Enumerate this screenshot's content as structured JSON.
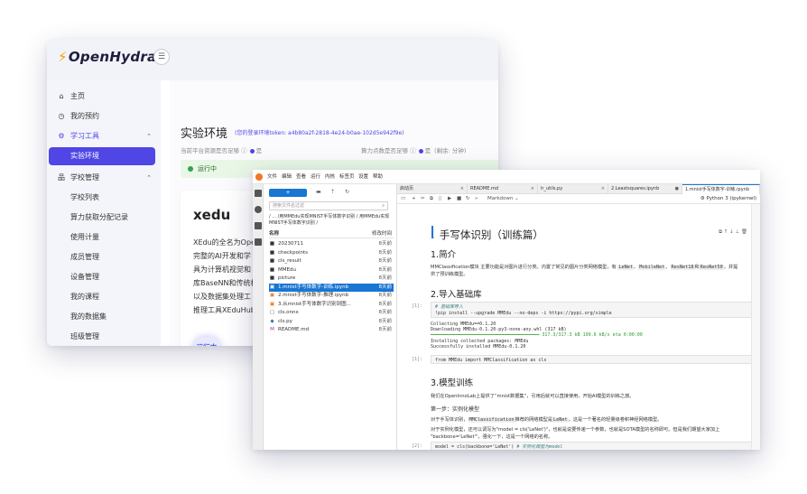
{
  "platform": {
    "logo_text": "OpenHydra",
    "collapse_icon": "collapse-icon",
    "nav": [
      {
        "label": "主页",
        "icon": "home-icon"
      },
      {
        "label": "我的预约",
        "icon": "clock-icon"
      },
      {
        "label": "学习工具",
        "icon": "gear-icon",
        "expanded_arrow": "⌃"
      },
      {
        "label": "实验环境",
        "active": true
      },
      {
        "label": "学校管理",
        "icon": "org-icon",
        "expanded_arrow": "⌃"
      },
      {
        "label": "学校列表"
      },
      {
        "label": "算力获取分配记录"
      },
      {
        "label": "使用计量"
      },
      {
        "label": "成员管理"
      },
      {
        "label": "设备管理"
      },
      {
        "label": "我的课程"
      },
      {
        "label": "我的数据集"
      },
      {
        "label": "班级管理"
      }
    ],
    "page_title": "实验环境",
    "token_text": "(您的登录环境token: a4b80a2f-2818-4e24-b0ae-102d5e942f9e)",
    "gpu_question": "当前平台资源是否足够",
    "gpu_answer": "是",
    "quota_question": "算力点数是否足够",
    "quota_answer": "是（剩余: 分钟)",
    "status": "运行中",
    "card": {
      "title": "xedu",
      "lines": [
        "XEdu的全名为Open",
        "完整的AI开发和学",
        "具为计算机视觉和",
        "库BaseNN和传统机",
        "以及数据集处理工",
        "推理工具XEduHub"
      ],
      "button": "运行中"
    }
  },
  "jupyter": {
    "menu": [
      "文件",
      "编辑",
      "查看",
      "运行",
      "内核",
      "标签页",
      "设置",
      "帮助"
    ],
    "file_browser": {
      "new_button": "+",
      "filter_placeholder": "搜索文件名过滤",
      "breadcrumb": "/ ... /用MMEdu实现MNIST手写体数字识别 / 用MMEdu实现MNIST手写体数字识别 /",
      "col_name": "名称",
      "col_modified": "修改时间",
      "files": [
        {
          "name": "20230711",
          "type": "folder",
          "modified": "8天前"
        },
        {
          "name": "checkpoints",
          "type": "folder",
          "modified": "8天前"
        },
        {
          "name": "cls_result",
          "type": "folder",
          "modified": "8天前"
        },
        {
          "name": "MMEdu",
          "type": "folder",
          "modified": "8天前"
        },
        {
          "name": "picture",
          "type": "folder",
          "modified": "8天前"
        },
        {
          "name": "1.mnist手写体数字-训练.ipynb",
          "type": "notebook",
          "modified": "8天前",
          "selected": true
        },
        {
          "name": "2.mnist手写体数字-推理.ipynb",
          "type": "notebook",
          "modified": "8天前"
        },
        {
          "name": "3.从mnist手写体数字识别到图...",
          "type": "notebook",
          "modified": "8天前"
        },
        {
          "name": "cls.onnx",
          "type": "file",
          "modified": "8天前"
        },
        {
          "name": "cls.py",
          "type": "python",
          "modified": "8天前"
        },
        {
          "name": "README.md",
          "type": "markdown",
          "modified": "8天前"
        }
      ]
    },
    "tabs": [
      {
        "label": "启动页"
      },
      {
        "label": "README.md"
      },
      {
        "label": "lr_utils.py"
      },
      {
        "label": "2.Leastsquares.ipynb"
      },
      {
        "label": "1.mnist手写体数字-训练.ipynb",
        "active": true
      }
    ],
    "toolbar": {
      "cell_type": "Markdown",
      "kernel": "Python 3 (ipykernel)"
    },
    "notebook": {
      "title": "手写体识别（训练篇）",
      "h_intro": "1.简介",
      "intro_text_a": "MMClassification模块 主要功能是对图片进行分类。内置了常见的图片分类网络模型，有",
      "intro_text_b": "供了预训练模型。",
      "intro_models": [
        "LeNet",
        "MobileNet",
        "ResNet18",
        "ResNet50"
      ],
      "intro_models_tail": "，并提",
      "h_import": "2.导入基础库",
      "cell1_prompt": "[1]:",
      "cell1_comment": "# 基础库导入",
      "cell1_code": "!pip install --upgrade MMEdu --no-deps -i https://pypi.org/simple",
      "cell1_output": [
        "Collecting MMEdu==0.1.20",
        "  Downloading MMEdu-0.1.20-py3-none-any.whl (317 kB)",
        "     ━━━━━━━━━━━━━━━━━━━━━━━━━━━━━━━━━━━━━━━━ 317.3/317.3 kB 199.6 kB/s eta 0:00:00",
        "Installing collected packages: MMEdu",
        "Successfully installed MMEdu-0.1.20"
      ],
      "cell2_prompt": "[1]:",
      "cell2_code": "from MMEdu import MMClassification as cls",
      "h_train": "3.模型训练",
      "train_p1": "我们在OpenInnoLab上提供了“mnist数据集”，引用后就可以直接使用，开始AI模型的训练之旅。",
      "train_step": "第一步：实例化模型",
      "train_p2_a": "对于手写体识别，",
      "train_p2_code": "MMClassification",
      "train_p2_b": "推荐的网络模型是",
      "train_p2_code2": "LeNet",
      "train_p2_c": "，这是一个著名的轻量级卷积神经网络模型。",
      "train_p3": "对于实例化模型，还可以调写为\"model = cls('LeNet')\"，也就是说要传递一个参数，也就是SOTA模型的名称即可。但是我们期望大家加上",
      "train_p3b": "\"backbone='LeNet'\"，强化一下，这是一个网络的名称。",
      "cell3_prompt": "[2]:",
      "cell3_code": "model = cls(backbone='LeNet')",
      "cell3_comment": "# 实例化模型为model"
    }
  }
}
